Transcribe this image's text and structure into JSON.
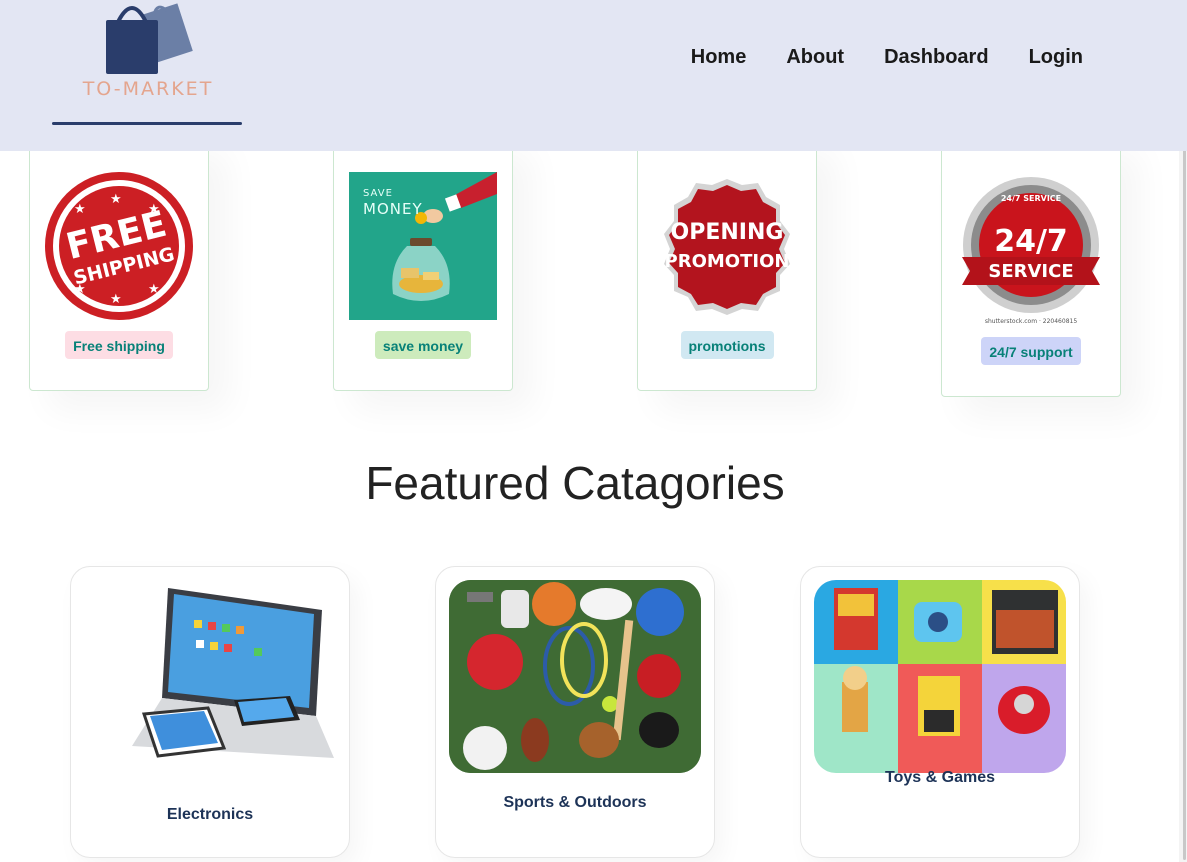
{
  "header": {
    "logo_text": "TO-MARKET",
    "nav": [
      {
        "label": "Home"
      },
      {
        "label": "About"
      },
      {
        "label": "Dashboard"
      },
      {
        "label": "Login"
      }
    ]
  },
  "features": [
    {
      "image_lines": [
        "FREE",
        "SHIPPING"
      ],
      "label": "Free shipping",
      "tag_color": "#fddde4"
    },
    {
      "image_lines": [
        "SAVE",
        "MONEY"
      ],
      "label": "save money",
      "tag_color": "#cdebbc"
    },
    {
      "image_lines": [
        "OPENING",
        "PROMOTION"
      ],
      "label": "promotions",
      "tag_color": "#d1e8f2"
    },
    {
      "image_lines": [
        "24/7 SERVICE",
        "24/7",
        "SERVICE",
        "shutterstock.com · 220460815"
      ],
      "label": "24/7 support",
      "tag_color": "#cdd4f8"
    }
  ],
  "featured_title": "Featured Catagories",
  "categories": [
    {
      "label": "Electronics"
    },
    {
      "label": "Sports & Outdoors"
    },
    {
      "label": "Toys & Games"
    }
  ],
  "colors": {
    "header_bg": "#e3e6f3",
    "logo_blue": "#2a3d6b",
    "logo_text": "#e4a58e",
    "accent_teal": "#088178",
    "category_label": "#1d3357"
  }
}
